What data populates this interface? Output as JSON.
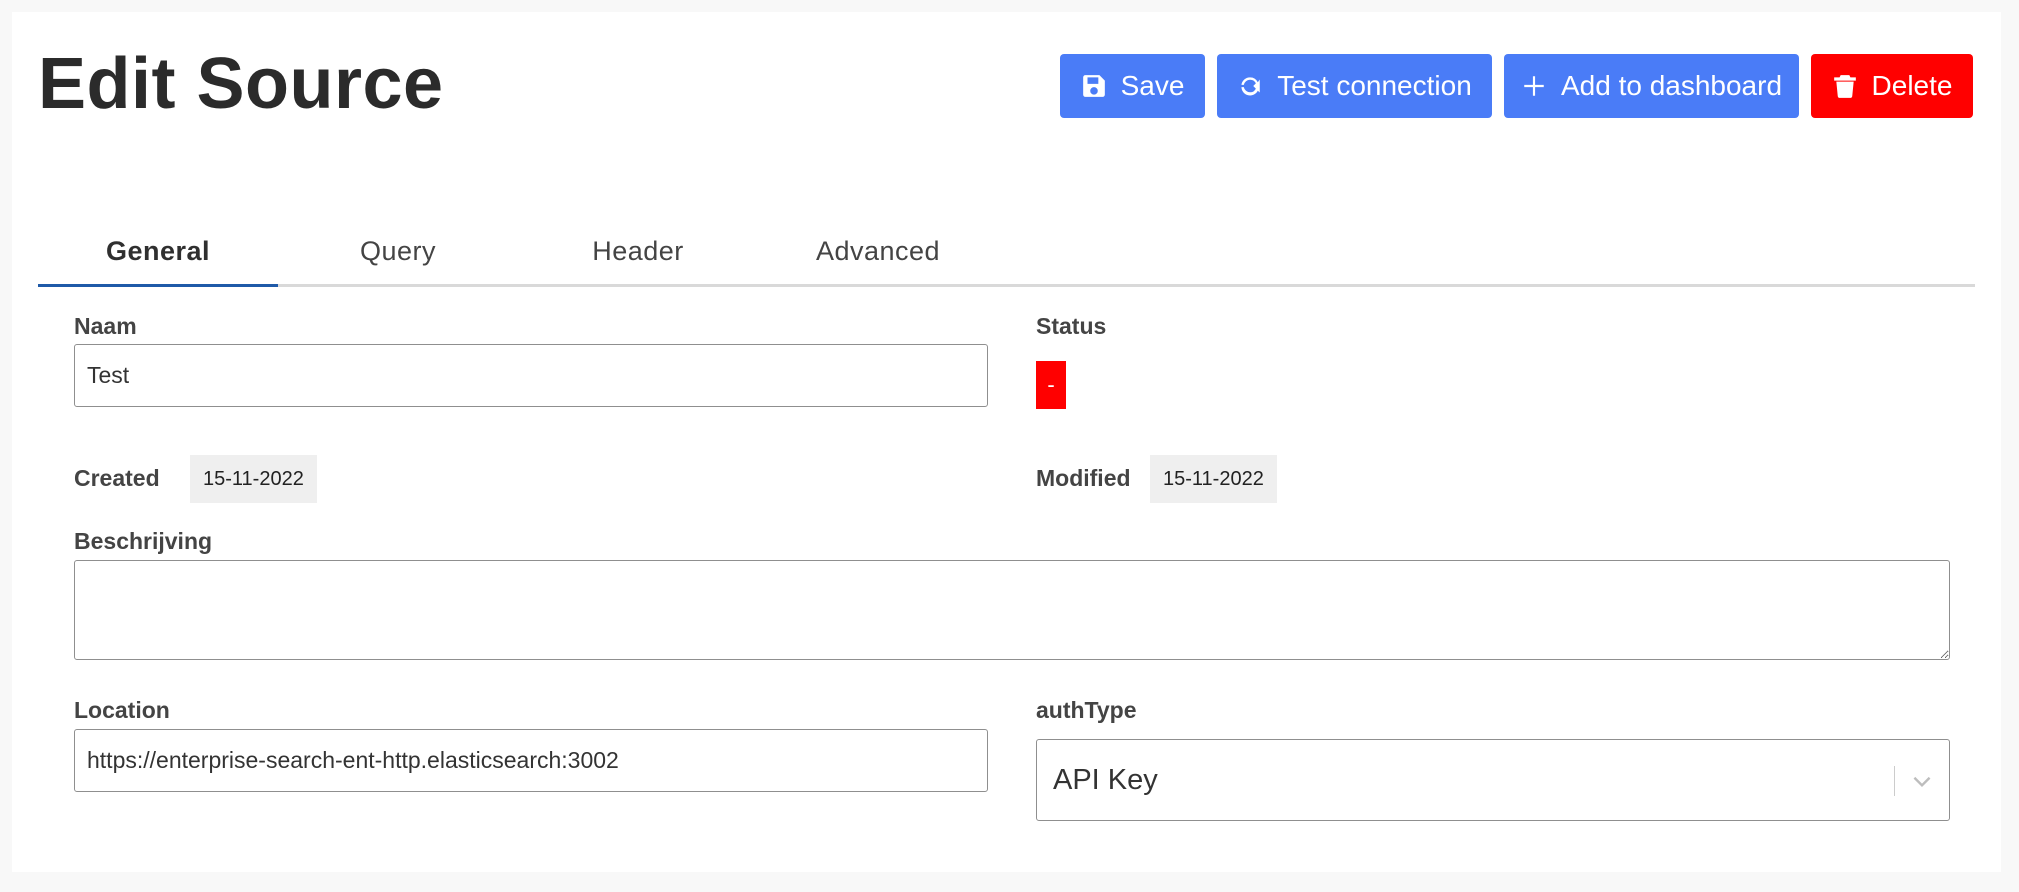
{
  "page": {
    "title": "Edit Source"
  },
  "toolbar": {
    "save_label": "Save",
    "test_label": "Test connection",
    "add_label": "Add to dashboard",
    "delete_label": "Delete"
  },
  "tabs": [
    {
      "label": "General",
      "active": true
    },
    {
      "label": "Query",
      "active": false
    },
    {
      "label": "Header",
      "active": false
    },
    {
      "label": "Advanced",
      "active": false
    }
  ],
  "form": {
    "naam": {
      "label": "Naam",
      "value": "Test"
    },
    "status": {
      "label": "Status",
      "value": "-"
    },
    "created": {
      "label": "Created",
      "value": "15-11-2022"
    },
    "modified": {
      "label": "Modified",
      "value": "15-11-2022"
    },
    "beschrijving": {
      "label": "Beschrijving",
      "value": ""
    },
    "location": {
      "label": "Location",
      "value": "https://enterprise-search-ent-http.elasticsearch:3002"
    },
    "authType": {
      "label": "authType",
      "value": "API Key"
    }
  },
  "icons": {
    "save": "floppy-disk-icon",
    "test": "refresh-icon",
    "add": "plus-icon",
    "delete": "trash-icon",
    "dropdown": "chevron-down-icon"
  },
  "colors": {
    "primary": "#4a7cf7",
    "danger": "#ff0000",
    "tab_active_underline": "#1f5aa8",
    "status_badge": "#ff0000"
  }
}
